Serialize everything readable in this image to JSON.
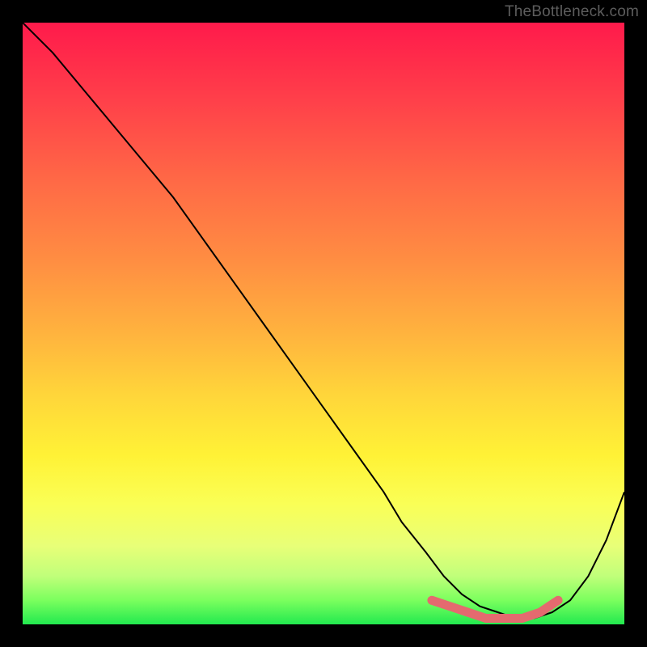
{
  "attribution": "TheBottleneck.com",
  "chart_data": {
    "type": "line",
    "title": "",
    "xlabel": "",
    "ylabel": "",
    "xlim": [
      0,
      100
    ],
    "ylim": [
      0,
      100
    ],
    "grid": false,
    "legend": false,
    "background_gradient": {
      "direction": "vertical",
      "stops": [
        {
          "pos": 0.0,
          "color": "#ff1a4b"
        },
        {
          "pos": 0.12,
          "color": "#ff3d4a"
        },
        {
          "pos": 0.26,
          "color": "#ff6846"
        },
        {
          "pos": 0.4,
          "color": "#ff8f42"
        },
        {
          "pos": 0.52,
          "color": "#ffb43e"
        },
        {
          "pos": 0.62,
          "color": "#ffd63a"
        },
        {
          "pos": 0.72,
          "color": "#fff236"
        },
        {
          "pos": 0.8,
          "color": "#faff56"
        },
        {
          "pos": 0.87,
          "color": "#e8ff78"
        },
        {
          "pos": 0.92,
          "color": "#c0ff7a"
        },
        {
          "pos": 0.96,
          "color": "#7bff5e"
        },
        {
          "pos": 1.0,
          "color": "#22e94f"
        }
      ]
    },
    "series": [
      {
        "name": "bottleneck-curve",
        "color": "#000000",
        "stroke_width": 2,
        "x": [
          0,
          5,
          10,
          15,
          20,
          25,
          30,
          35,
          40,
          45,
          50,
          55,
          60,
          63,
          67,
          70,
          73,
          76,
          79,
          82,
          85,
          88,
          91,
          94,
          97,
          100
        ],
        "y": [
          100,
          95,
          89,
          83,
          77,
          71,
          64,
          57,
          50,
          43,
          36,
          29,
          22,
          17,
          12,
          8,
          5,
          3,
          2,
          1,
          1,
          2,
          4,
          8,
          14,
          22
        ]
      },
      {
        "name": "optimal-range-marker",
        "color": "#e46a6f",
        "stroke_width": 10,
        "stroke_linecap": "round",
        "x": [
          68,
          71,
          74,
          77,
          80,
          83,
          86,
          89
        ],
        "y": [
          4,
          3,
          2,
          1,
          1,
          1,
          2,
          4
        ]
      }
    ]
  }
}
